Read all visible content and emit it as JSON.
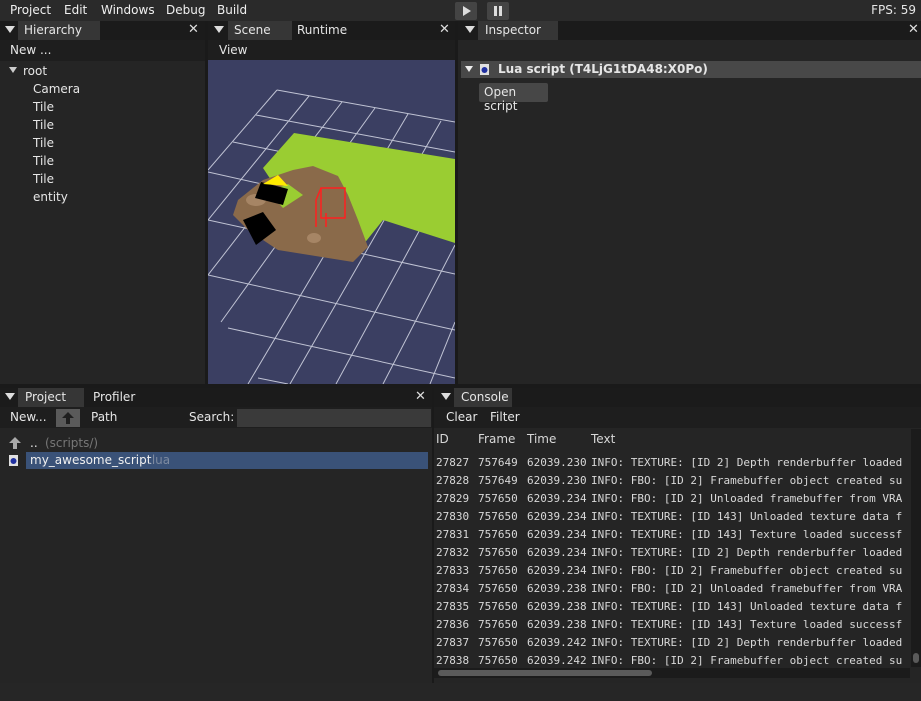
{
  "menu": [
    "Project",
    "Edit",
    "Windows",
    "Debug",
    "Build"
  ],
  "fps": "FPS: 59",
  "hierarchy": {
    "tab": "Hierarchy",
    "new_label": "New ...",
    "root": "root",
    "children": [
      "Camera",
      "Tile",
      "Tile",
      "Tile",
      "Tile",
      "Tile",
      "entity"
    ]
  },
  "scene": {
    "tab_scene": "Scene",
    "tab_runtime": "Runtime",
    "view_menu": "View"
  },
  "inspector": {
    "tab": "Inspector",
    "component_title": "Lua script (T4LjG1tDA48:X0Po)",
    "open_button": "Open script"
  },
  "project": {
    "tab_project": "Project",
    "tab_profiler": "Profiler",
    "new_label": "New...",
    "path_label": "Path",
    "search_label": "Search:",
    "search_value": "",
    "parent_name": "..",
    "parent_hint": "(scripts/)",
    "file_name": "my_awesome_script",
    "file_ext": ".lua"
  },
  "console": {
    "tab": "Console",
    "clear_label": "Clear",
    "filter_label": "Filter",
    "columns": [
      "ID",
      "Frame",
      "Time",
      "Text"
    ],
    "rows": [
      {
        "id": "27827",
        "frame": "757649",
        "time": "62039.230",
        "text": "INFO:    TEXTURE: [ID 2] Depth renderbuffer loaded"
      },
      {
        "id": "27828",
        "frame": "757649",
        "time": "62039.230",
        "text": "INFO:    FBO: [ID 2] Framebuffer object created su"
      },
      {
        "id": "27829",
        "frame": "757650",
        "time": "62039.234",
        "text": "INFO:    FBO: [ID 2] Unloaded framebuffer from VRA"
      },
      {
        "id": "27830",
        "frame": "757650",
        "time": "62039.234",
        "text": "INFO:    TEXTURE: [ID 143] Unloaded texture data f"
      },
      {
        "id": "27831",
        "frame": "757650",
        "time": "62039.234",
        "text": "INFO:    TEXTURE: [ID 143] Texture loaded successf"
      },
      {
        "id": "27832",
        "frame": "757650",
        "time": "62039.234",
        "text": "INFO:    TEXTURE: [ID 2] Depth renderbuffer loaded"
      },
      {
        "id": "27833",
        "frame": "757650",
        "time": "62039.234",
        "text": "INFO:    FBO: [ID 2] Framebuffer object created su"
      },
      {
        "id": "27834",
        "frame": "757650",
        "time": "62039.238",
        "text": "INFO:    FBO: [ID 2] Unloaded framebuffer from VRA"
      },
      {
        "id": "27835",
        "frame": "757650",
        "time": "62039.238",
        "text": "INFO:    TEXTURE: [ID 143] Unloaded texture data f"
      },
      {
        "id": "27836",
        "frame": "757650",
        "time": "62039.238",
        "text": "INFO:    TEXTURE: [ID 143] Texture loaded successf"
      },
      {
        "id": "27837",
        "frame": "757650",
        "time": "62039.242",
        "text": "INFO:    TEXTURE: [ID 2] Depth renderbuffer loaded"
      },
      {
        "id": "27838",
        "frame": "757650",
        "time": "62039.242",
        "text": "INFO:    FBO: [ID 2] Framebuffer object created su"
      }
    ]
  },
  "icons": {
    "play": "play-icon",
    "pause": "pause-icon",
    "close": "close-icon",
    "collapse": "triangle-down-icon",
    "up": "arrow-up-icon",
    "lua": "lua-script-icon"
  },
  "colors": {
    "selection": "#3a5278",
    "viewport_bg": "#3b3f62",
    "grass": "#9acd32",
    "dirt": "#8a6a4a"
  }
}
